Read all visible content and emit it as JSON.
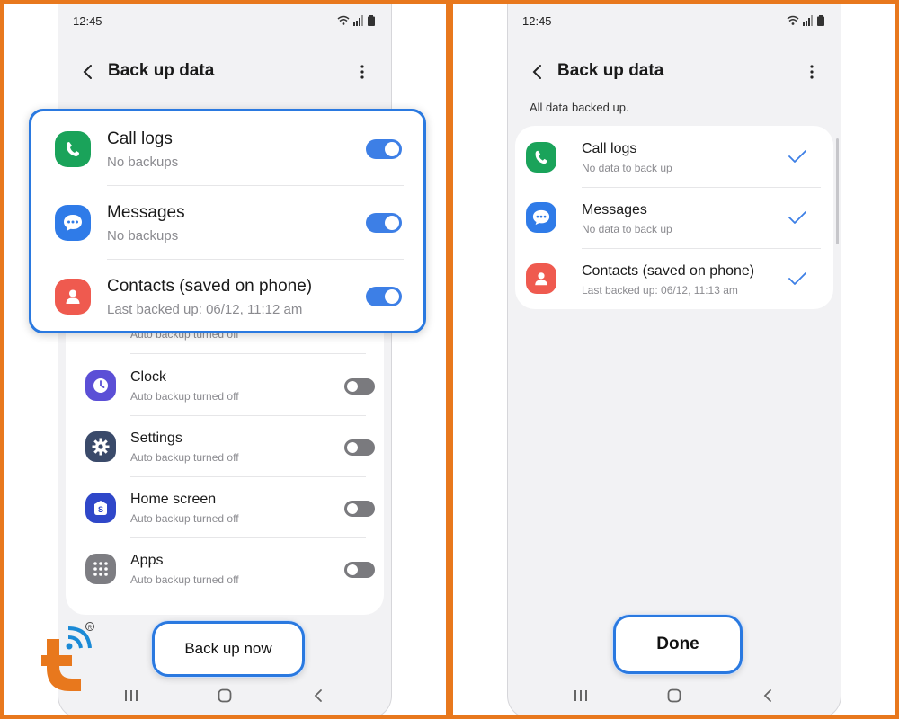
{
  "left_screen": {
    "status_time": "12:45",
    "title": "Back up data",
    "highlighted_items": [
      {
        "label": "Call logs",
        "subtitle": "No backups",
        "icon": "phone-icon",
        "color": "#1aa35a"
      },
      {
        "label": "Messages",
        "subtitle": "No backups",
        "icon": "chat-bubble-icon",
        "color": "#2f7be8"
      },
      {
        "label": "Contacts (saved on phone)",
        "subtitle": "Last backed up: 06/12, 11:12 am",
        "icon": "person-icon",
        "color": "#ef5a4f"
      }
    ],
    "partial_item_subtitle": "Auto backup turned off",
    "items": [
      {
        "label": "Clock",
        "subtitle": "Auto backup turned off",
        "icon": "clock-icon",
        "color": "#5b4fd6"
      },
      {
        "label": "Settings",
        "subtitle": "Auto backup turned off",
        "icon": "gear-icon",
        "color": "#3a4a6a"
      },
      {
        "label": "Home screen",
        "subtitle": "Auto backup turned off",
        "icon": "home-screen-icon",
        "color": "#2f47c9"
      },
      {
        "label": "Apps",
        "subtitle": "Auto backup turned off",
        "icon": "apps-grid-icon",
        "color": "#7d7d82"
      }
    ],
    "backup_button": "Back up now"
  },
  "right_screen": {
    "status_time": "12:45",
    "title": "Back up data",
    "status_message": "All data backed up.",
    "items": [
      {
        "label": "Call logs",
        "subtitle": "No data to back up",
        "icon": "phone-icon",
        "color": "#1aa35a"
      },
      {
        "label": "Messages",
        "subtitle": "No data to back up",
        "icon": "chat-bubble-icon",
        "color": "#2f7be8"
      },
      {
        "label": "Contacts (saved on phone)",
        "subtitle": "Last backed up: 06/12, 11:13 am",
        "icon": "person-icon",
        "color": "#ef5a4f"
      }
    ],
    "done_button": "Done"
  },
  "accent_color": "#2a79e0",
  "frame_color": "#e8781d"
}
